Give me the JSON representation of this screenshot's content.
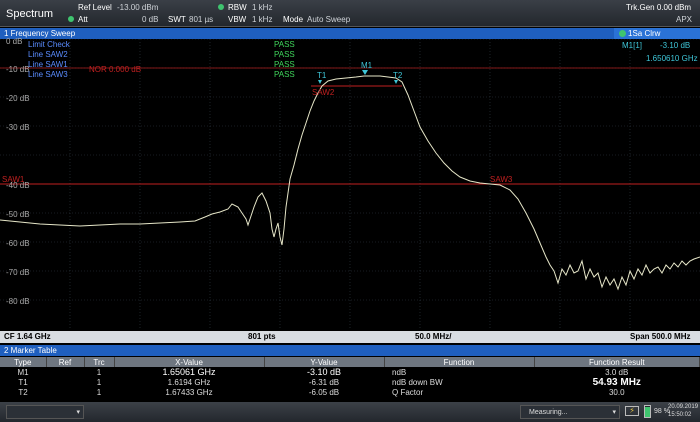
{
  "topbar": {
    "title": "Spectrum",
    "ref_level_label": "Ref Level",
    "ref_level_value": "-13.00 dBm",
    "att_label": "Att",
    "att_value": "0 dB",
    "swt_label": "SWT",
    "swt_value": "801 µs",
    "rbw_label": "RBW",
    "rbw_value": "1 kHz",
    "vbw_label": "VBW",
    "vbw_value": "1 kHz",
    "mode_label": "Mode",
    "mode_value": "Auto Sweep",
    "trkgen": "Trk.Gen 0.00 dBm",
    "apx": "APX"
  },
  "window": {
    "name": "1 Frequency Sweep",
    "trace": "1Sa Clrw"
  },
  "plot": {
    "limit_labels": [
      "Limit Check",
      "Line SAW2",
      "Line SAW1",
      "Line SAW3"
    ],
    "pass_labels": [
      "PASS",
      "PASS",
      "PASS",
      "PASS"
    ],
    "nor_label": "NOR 0.000 dB",
    "y_ticks": [
      "0 dB",
      "-10 dB",
      "-20 dB",
      "-30 dB",
      "-40 dB",
      "-50 dB",
      "-60 dB",
      "-70 dB",
      "-80 dB"
    ],
    "saw1": "SAW1",
    "saw2": "SAW2",
    "saw3": "SAW3",
    "marker_m1": "M1",
    "marker_t1": "T1",
    "marker_t2": "T2",
    "marker_readout_name": "M1[1]",
    "marker_readout_level": "-3.10 dB",
    "marker_readout_freq": "1.650610 GHz"
  },
  "axis": {
    "cf": "CF 1.64 GHz",
    "pts": "801 pts",
    "per_div": "50.0 MHz/",
    "span": "Span 500.0 MHz"
  },
  "marker_table": {
    "title": "2 Marker Table",
    "headers": [
      "Type",
      "Ref",
      "Trc",
      "X-Value",
      "Y-Value",
      "Function",
      "Function Result"
    ],
    "rows": [
      [
        "M1",
        "",
        "1",
        "1.65061 GHz",
        "-3.10 dB",
        "ndB",
        "3.0 dB"
      ],
      [
        "T1",
        "",
        "1",
        "1.6194 GHz",
        "-6.31 dB",
        "ndB down BW",
        "54.93 MHz"
      ],
      [
        "T2",
        "",
        "1",
        "1.67433 GHz",
        "-6.05 dB",
        "Q Factor",
        "30.0"
      ]
    ]
  },
  "status": {
    "measuring": "Measuring...",
    "battery": "98 %",
    "date": "20.09.2019",
    "time": "15:50:02"
  },
  "colors": {
    "trace": "#e6e6c8",
    "limit": "#c02020",
    "header": "#1f5fbf",
    "pass": "#3fd35a",
    "marker": "#3ec6d8"
  }
}
